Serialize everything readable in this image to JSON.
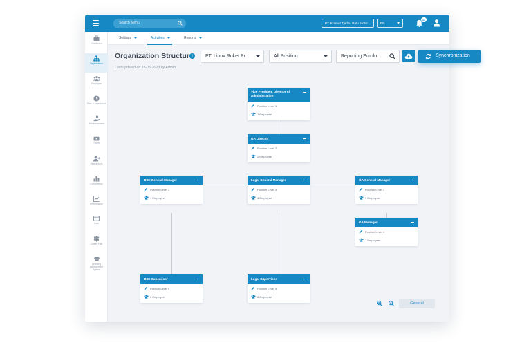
{
  "topbar": {
    "search_placeholder": "Search Menu",
    "company": "PT. Kramat Tjadhu Ratu Motor",
    "language": "EN",
    "notification_count": "13"
  },
  "sidebar": {
    "items": [
      {
        "label": "Dashboard",
        "icon": "briefcase-icon"
      },
      {
        "label": "Organization",
        "icon": "org-chart-icon",
        "active": true
      },
      {
        "label": "Employee",
        "icon": "people-icon"
      },
      {
        "label": "Time & Attendance",
        "icon": "clock-icon"
      },
      {
        "label": "Reimbursement",
        "icon": "hand-money-icon"
      },
      {
        "label": "Travel",
        "icon": "suitcase-icon"
      },
      {
        "label": "Recruitment",
        "icon": "add-user-icon"
      },
      {
        "label": "Competency",
        "icon": "bar-chart-icon"
      },
      {
        "label": "Performance",
        "icon": "trend-chart-icon"
      },
      {
        "label": "Loan",
        "icon": "card-icon"
      },
      {
        "label": "Career Path",
        "icon": "signpost-icon"
      },
      {
        "label": "Learning Management System",
        "icon": "graduation-cap-icon"
      }
    ]
  },
  "subnav": {
    "tabs": [
      {
        "label": "Settings"
      },
      {
        "label": "Activities",
        "active": true
      },
      {
        "label": "Reports"
      }
    ]
  },
  "header": {
    "title": "Organization Structure",
    "updated_prefix": "Last updated on 16-05-2023 by Admin"
  },
  "filters": {
    "company": "PT. Linov Roket Pr...",
    "position": "All Position",
    "reporting": "Reporting Emplo..."
  },
  "actions": {
    "sync_label": "Synchronization"
  },
  "org_chart": {
    "nodes": [
      {
        "title": "Vice President Director of Administration",
        "level": "Position Level 1",
        "employees": "1 Employee"
      },
      {
        "title": "GA Director",
        "level": "Position Level 2",
        "employees": "2 Employee"
      },
      {
        "title": "HSE General Manager",
        "level": "Position Level 3",
        "employees": "1 Employee"
      },
      {
        "title": "Legal General Manager",
        "level": "Position Level 3",
        "employees": "4 Employee"
      },
      {
        "title": "GA General Manager",
        "level": "Position Level 3",
        "employees": "3 Employee"
      },
      {
        "title": "GA Manager",
        "level": "Position Level 4",
        "employees": "1 Employee"
      },
      {
        "title": "HSE Supervisor",
        "level": "Position Level 5",
        "employees": "2 Employee"
      },
      {
        "title": "Legal Supervisor",
        "level": "Position Level 5",
        "employees": "8 Employee"
      }
    ]
  },
  "footer": {
    "view_label": "General"
  },
  "colors": {
    "accent": "#1689c4",
    "background": "#f1f3f7",
    "connector": "#c8cdd4"
  }
}
